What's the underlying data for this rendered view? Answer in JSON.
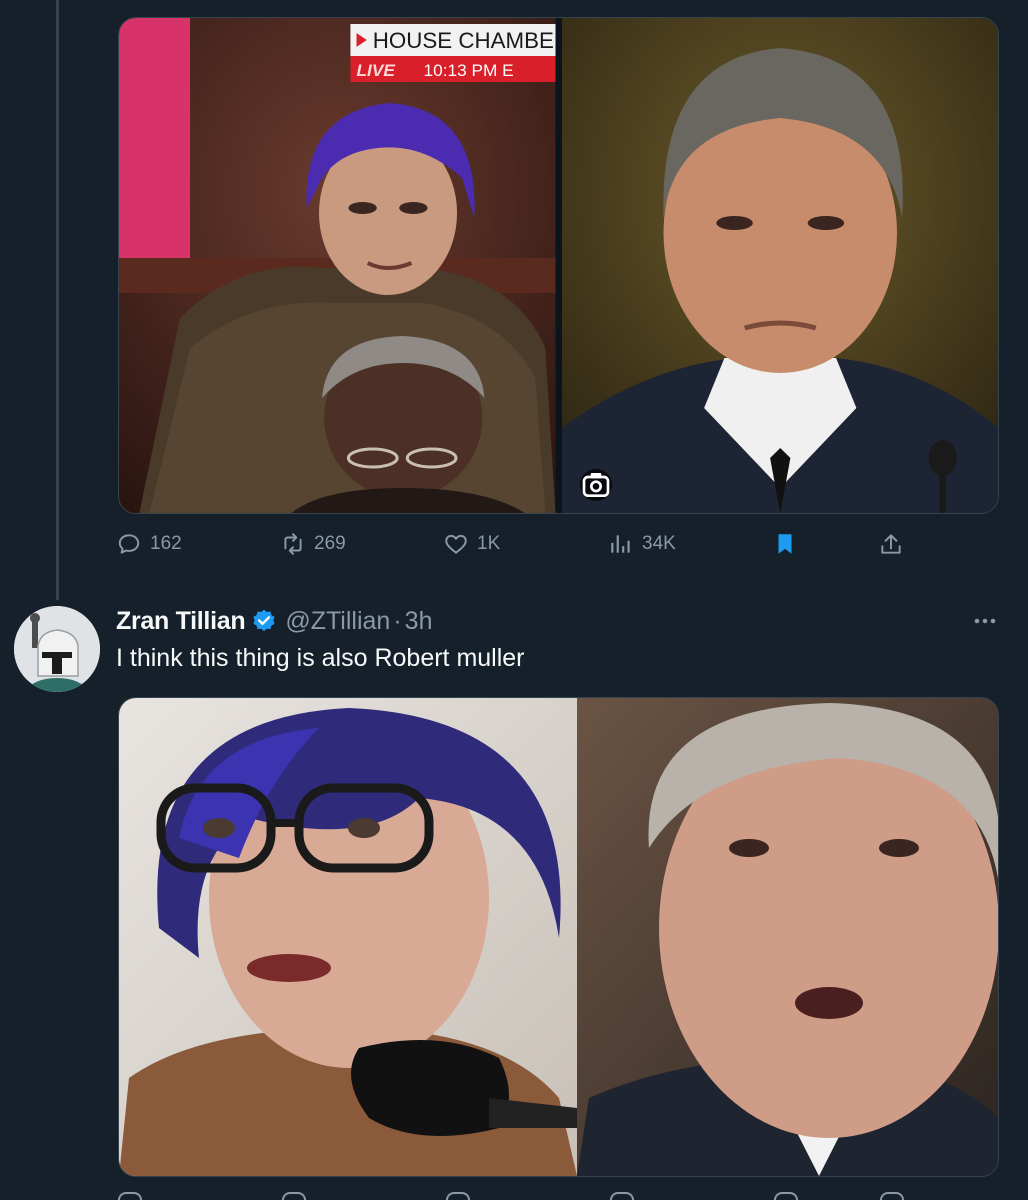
{
  "tweet1": {
    "media": {
      "left": {
        "description_icon": "person-photo",
        "overlay": {
          "title": "HOUSE CHAMBE",
          "live": "LIVE",
          "time": "10:13 PM E"
        }
      },
      "right": {
        "description_icon": "person-photo",
        "badge_icon": "camera-icon"
      }
    },
    "actions": {
      "replies": "162",
      "retweets": "269",
      "likes": "1K",
      "views": "34K"
    },
    "colors": {
      "bookmark_active": "#1d9bf0"
    }
  },
  "tweet2": {
    "author": {
      "name": "Zran Tillian",
      "handle": "@ZTillian",
      "separator": "·",
      "time": "3h",
      "verified": true
    },
    "text": "I think this thing is also Robert muller",
    "media": {
      "description_icon": "person-photo"
    }
  },
  "colors": {
    "background": "#15202b",
    "muted_text": "#8b98a5",
    "border": "#38444d",
    "accent": "#1d9bf0"
  }
}
